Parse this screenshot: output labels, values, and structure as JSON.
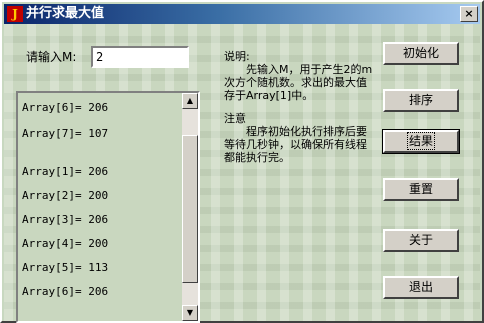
{
  "window": {
    "title": "并行求最大值",
    "icon_name": "app-icon",
    "icon_glyph": "J",
    "close_glyph": "×"
  },
  "input_m": {
    "label": "请输入M:",
    "value": "2"
  },
  "description": {
    "heading": "说明:",
    "body": "先输入M，用于产生2的m次方个随机数。求出的最大值存于Array[1]中。"
  },
  "note": {
    "heading": "注意",
    "body": "程序初始化执行排序后要等待几秒钟，以确保所有线程都能执行完。"
  },
  "list": {
    "items": [
      "Array[6]= 206",
      "Array[7]= 107",
      "",
      "Array[1]=  206",
      "Array[2]=  200",
      "Array[3]=  206",
      "Array[4]=  200",
      "Array[5]=  113",
      "Array[6]=  206"
    ]
  },
  "buttons": {
    "init": "初始化",
    "sort": "排序",
    "result": "结果",
    "reset": "重置",
    "about": "关于",
    "exit": "退出"
  }
}
